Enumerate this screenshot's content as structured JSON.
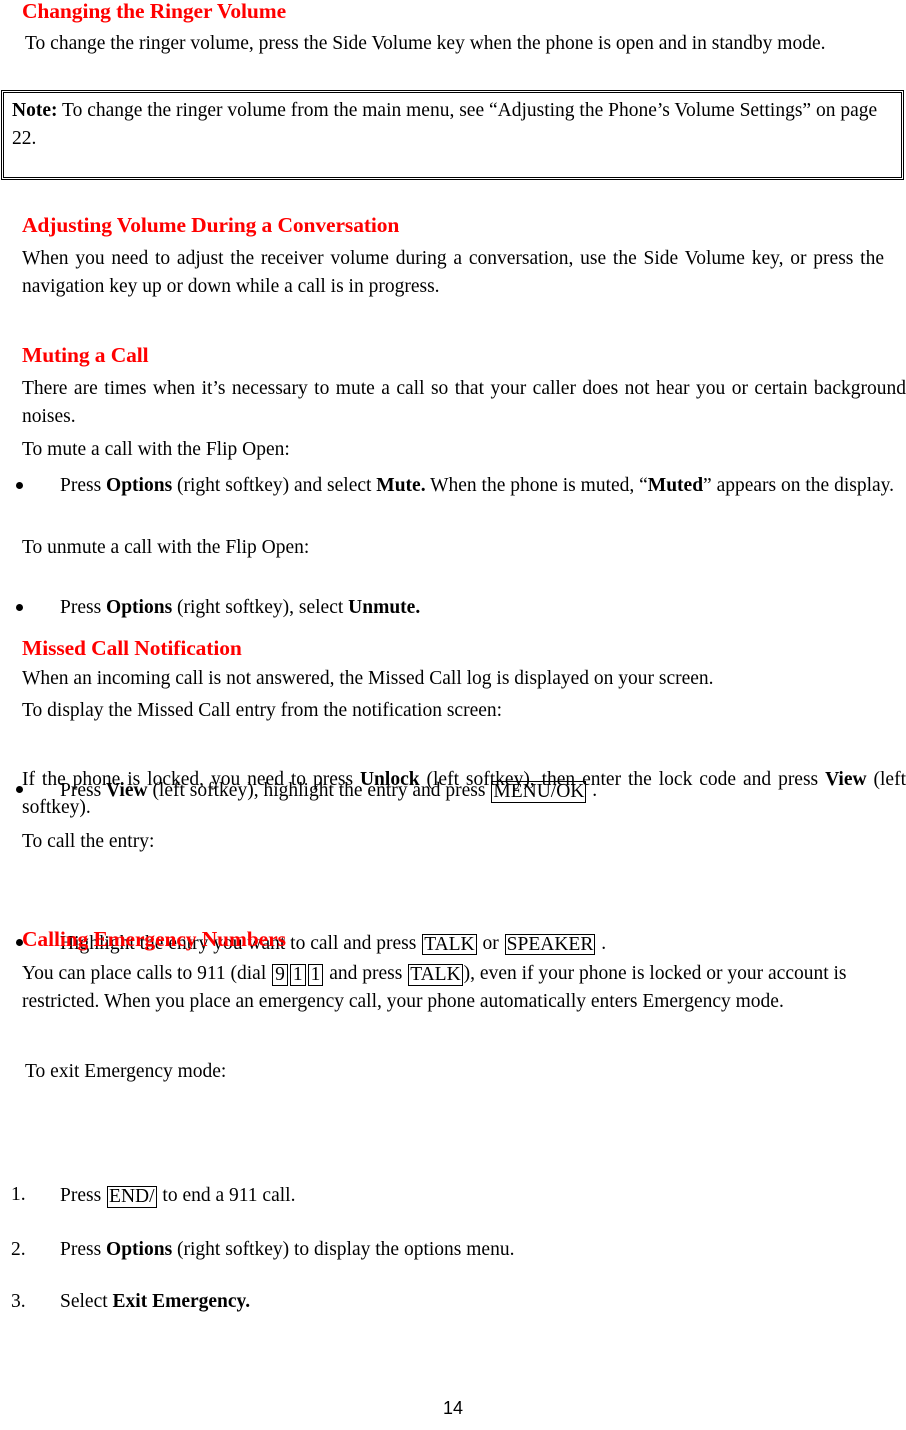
{
  "document": {
    "page_number": "14"
  },
  "sections": [
    {
      "id": "changing-ringer-volume",
      "heading": "Changing the Ringer Volume",
      "paragraph": "To change the ringer volume, press the Side Volume key when the phone is open and in standby mode.",
      "note": {
        "label": "Note:",
        "text": "To change the ringer volume from the main menu, see “Adjusting the Phone’s Volume Settings” on page 22."
      }
    },
    {
      "id": "adjusting-volume-during-conversation",
      "heading": "Adjusting Volume During a Conversation",
      "paragraph": "When you need to adjust the receiver volume during a conversation, use the Side Volume key, or press the navigation key up or down while a call is in progress."
    },
    {
      "id": "muting-a-call",
      "heading": "Muting a Call",
      "paragraph": "There are times when it’s necessary to mute a call so that your caller does not hear you or certain background noises.",
      "lead_mute": "To mute a call with the Flip Open:",
      "bullet_mute": {
        "p1": "Press ",
        "b1": "Options",
        "p2": " (right softkey) and select ",
        "b2": "Mute.",
        "p3": " When the phone is muted, “",
        "b3": "Muted",
        "p4": "” appears on the display."
      },
      "lead_unmute": "To unmute a call with the Flip Open:",
      "bullet_unmute": {
        "p1": "Press ",
        "b1": "Options",
        "p2": " (right softkey), select ",
        "b2": "Unmute."
      }
    },
    {
      "id": "missed-call-notification",
      "heading": "Missed Call Notification",
      "paragraph": "When an incoming call is not answered, the Missed Call log is displayed on your screen.",
      "lead_display": "To display the Missed Call entry from the notification screen:",
      "bullet_display": {
        "p1": "Press ",
        "b1": "View",
        "p2": " (left softkey), highlight the entry and press ",
        "key1": "MENU/OK",
        "p3": " ."
      },
      "locked_note": {
        "p1": "If the phone is locked, you need to press ",
        "b1": "Unlock",
        "p2": " (left softkey), then enter the lock code and press ",
        "b2": "View",
        "p3": " (left softkey)."
      },
      "lead_call": "To call the entry:",
      "bullet_call": {
        "p1": "Highlight the entry you want to call and press ",
        "key1": "TALK",
        "p2": " or ",
        "key2": "SPEAKER",
        "p3": " ."
      }
    },
    {
      "id": "calling-emergency-numbers",
      "heading": "Calling Emergency Numbers",
      "paragraph": {
        "p1": "You can place calls to 911 (dial ",
        "key9": "9",
        "key1a": "1",
        "key1b": "1",
        "p2": " and press ",
        "keyTalk": "TALK",
        "p3": "), even if your phone is locked or your account is restricted. When you place an emergency call, your phone automatically enters Emergency mode."
      },
      "lead_exit": "To exit Emergency mode:",
      "steps": [
        {
          "num": "1.",
          "p1": "Press ",
          "key1": "END/",
          "p2": " to end a 911 call."
        },
        {
          "num": "2.",
          "p1": "Press ",
          "b1": "Options",
          "p2": " (right softkey) to display the options menu."
        },
        {
          "num": "3.",
          "p1": "Select ",
          "b1": "Exit Emergency."
        }
      ]
    }
  ]
}
